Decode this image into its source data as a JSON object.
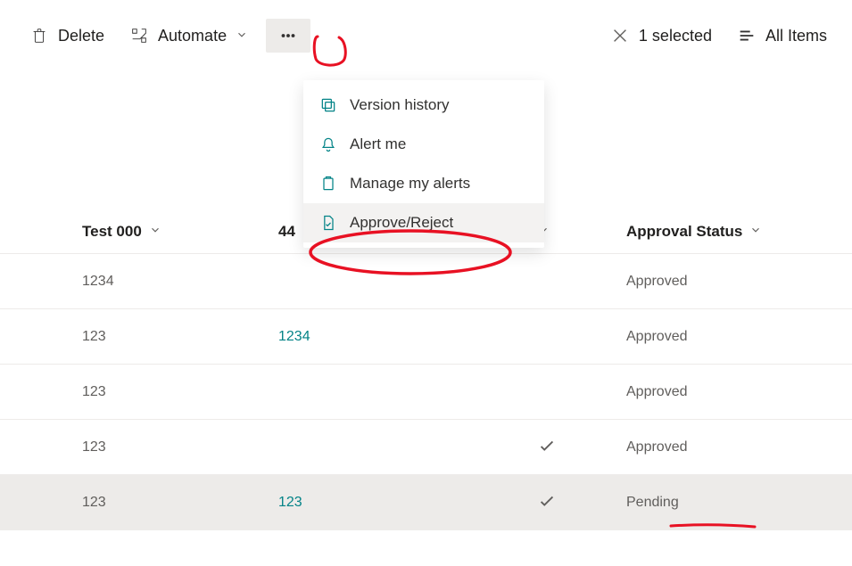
{
  "toolbar": {
    "delete": "Delete",
    "automate": "Automate",
    "selected": "1 selected",
    "allitems": "All Items"
  },
  "menu": {
    "version": "Version history",
    "alert": "Alert me",
    "manage": "Manage my alerts",
    "approve": "Approve/Reject"
  },
  "columns": {
    "col1": "Test 000",
    "col2": "44",
    "col3": "",
    "col4": "Approval Status"
  },
  "rows": [
    {
      "c1": "1234",
      "c2": "",
      "check": false,
      "status": "Approved",
      "selected": false
    },
    {
      "c1": "123",
      "c2": "1234",
      "check": false,
      "status": "Approved",
      "selected": false
    },
    {
      "c1": "123",
      "c2": "",
      "check": false,
      "status": "Approved",
      "selected": false
    },
    {
      "c1": "123",
      "c2": "",
      "check": true,
      "status": "Approved",
      "selected": false
    },
    {
      "c1": "123",
      "c2": "123",
      "check": true,
      "status": "Pending",
      "selected": true
    }
  ]
}
